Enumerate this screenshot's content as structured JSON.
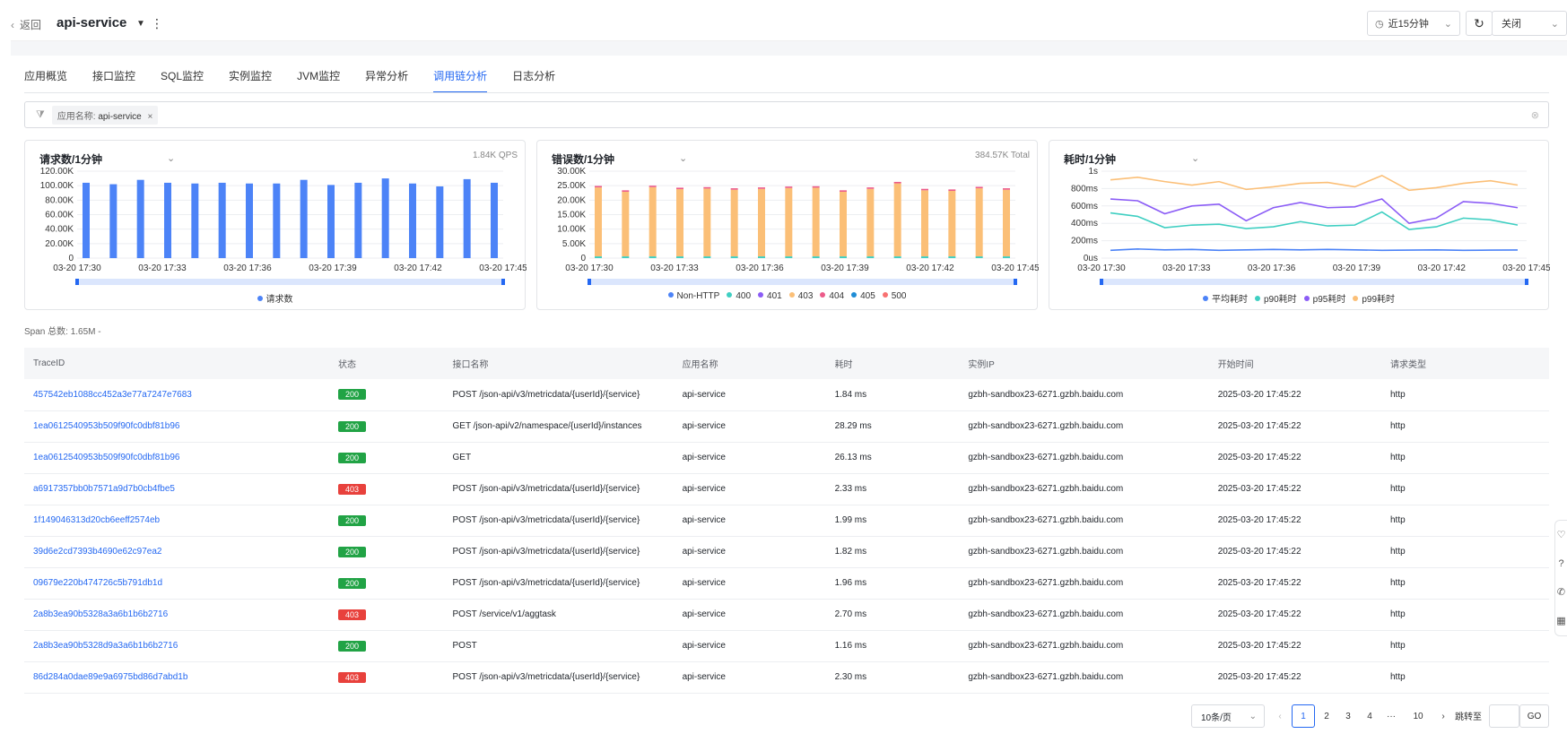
{
  "header": {
    "back_label": "返回",
    "service_name": "api-service",
    "time_range": "近15分钟",
    "refresh_mode": "关闭"
  },
  "tabs": [
    "应用概览",
    "接口监控",
    "SQL监控",
    "实例监控",
    "JVM监控",
    "异常分析",
    "调用链分析",
    "日志分析"
  ],
  "active_tab": "调用链分析",
  "filter": {
    "chip_key": "应用名称:",
    "chip_value": "api-service"
  },
  "colors": {
    "accent": "#2468f2",
    "ok": "#21a345",
    "error": "#e8413c"
  },
  "chart_data": [
    {
      "type": "bar",
      "title": "请求数/1分钟",
      "stat": "1.84K QPS",
      "x_ticks": [
        "03-20 17:30",
        "03-20 17:33",
        "03-20 17:36",
        "03-20 17:39",
        "03-20 17:42",
        "03-20 17:45"
      ],
      "y_ticks": [
        "120.00K",
        "100.00K",
        "80.00K",
        "60.00K",
        "40.00K",
        "20.00K",
        "0"
      ],
      "ylim": [
        0,
        120000
      ],
      "series": [
        {
          "name": "请求数",
          "color": "#4c83f7",
          "values": [
            104000,
            102000,
            108000,
            104000,
            103000,
            104000,
            103000,
            103000,
            108000,
            101000,
            104000,
            110000,
            103000,
            99000,
            109000,
            104000
          ]
        }
      ],
      "legend": [
        "请求数"
      ]
    },
    {
      "type": "bar",
      "stacked": true,
      "title": "错误数/1分钟",
      "stat": "384.57K Total",
      "x_ticks": [
        "03-20 17:30",
        "03-20 17:33",
        "03-20 17:36",
        "03-20 17:39",
        "03-20 17:42",
        "03-20 17:45"
      ],
      "y_ticks": [
        "30.00K",
        "25.00K",
        "20.00K",
        "15.00K",
        "10.00K",
        "5.00K",
        "0"
      ],
      "ylim": [
        0,
        30000
      ],
      "series": [
        {
          "name": "Non-HTTP",
          "color": "#4c83f7",
          "values": [
            0,
            0,
            0,
            0,
            0,
            0,
            0,
            0,
            0,
            0,
            0,
            0,
            0,
            0,
            0,
            0
          ]
        },
        {
          "name": "400",
          "color": "#3fcfc2",
          "values": [
            600,
            600,
            600,
            600,
            600,
            600,
            600,
            600,
            600,
            600,
            600,
            600,
            600,
            600,
            600,
            600
          ]
        },
        {
          "name": "401",
          "color": "#8b5cf6",
          "values": [
            0,
            0,
            0,
            0,
            0,
            0,
            0,
            0,
            0,
            0,
            0,
            0,
            0,
            0,
            0,
            0
          ]
        },
        {
          "name": "403",
          "color": "#fbbf77",
          "values": [
            23800,
            22300,
            23900,
            23200,
            23400,
            23000,
            23300,
            23600,
            23700,
            22300,
            23300,
            25200,
            22800,
            22600,
            23500,
            23000
          ]
        },
        {
          "name": "404",
          "color": "#ec5b8a",
          "values": [
            500,
            500,
            500,
            500,
            500,
            500,
            500,
            500,
            500,
            500,
            500,
            500,
            500,
            500,
            500,
            500
          ]
        },
        {
          "name": "405",
          "color": "#1f8dd6",
          "values": [
            0,
            0,
            0,
            0,
            0,
            0,
            0,
            0,
            0,
            0,
            0,
            0,
            0,
            0,
            0,
            0
          ]
        },
        {
          "name": "500",
          "color": "#f87171",
          "values": [
            0,
            0,
            0,
            0,
            0,
            0,
            0,
            0,
            0,
            0,
            0,
            0,
            0,
            0,
            0,
            0
          ]
        }
      ],
      "legend": [
        "Non-HTTP",
        "400",
        "401",
        "403",
        "404",
        "405",
        "500"
      ]
    },
    {
      "type": "line",
      "title": "耗时/1分钟",
      "x_ticks": [
        "03-20 17:30",
        "03-20 17:33",
        "03-20 17:36",
        "03-20 17:39",
        "03-20 17:42",
        "03-20 17:45"
      ],
      "y_ticks": [
        "1s",
        "800ms",
        "600ms",
        "400ms",
        "200ms",
        "0us"
      ],
      "ylim": [
        0,
        1000
      ],
      "series": [
        {
          "name": "平均耗时",
          "color": "#4c83f7",
          "values": [
            90,
            105,
            95,
            100,
            90,
            95,
            100,
            95,
            100,
            95,
            90,
            92,
            95,
            90,
            92,
            93
          ]
        },
        {
          "name": "p90耗时",
          "color": "#3fcfc2",
          "values": [
            520,
            480,
            350,
            380,
            390,
            340,
            360,
            420,
            370,
            380,
            530,
            330,
            360,
            460,
            440,
            380
          ]
        },
        {
          "name": "p95耗时",
          "color": "#8b5cf6",
          "values": [
            680,
            660,
            510,
            600,
            620,
            430,
            580,
            640,
            580,
            590,
            680,
            400,
            460,
            650,
            630,
            580
          ]
        },
        {
          "name": "p99耗时",
          "color": "#fbbf77",
          "values": [
            900,
            930,
            880,
            840,
            880,
            790,
            820,
            860,
            870,
            820,
            950,
            780,
            810,
            860,
            890,
            840
          ]
        }
      ],
      "legend": [
        "平均耗时",
        "p90耗时",
        "p95耗时",
        "p99耗时"
      ]
    }
  ],
  "span_total": "Span 总数:  1.65M -",
  "table": {
    "headers": [
      "TraceID",
      "状态",
      "接口名称",
      "应用名称",
      "耗时",
      "实例IP",
      "开始时间",
      "请求类型"
    ],
    "rows": [
      [
        "457542eb1088cc452a3e77a7247e7683",
        "200",
        "POST /json-api/v3/metricdata/{userId}/{service}",
        "api-service",
        "1.84 ms",
        "gzbh-sandbox23-6271.gzbh.baidu.com",
        "2025-03-20 17:45:22",
        "http"
      ],
      [
        "1ea0612540953b509f90fc0dbf81b96",
        "200",
        "GET /json-api/v2/namespace/{userId}/instances",
        "api-service",
        "28.29 ms",
        "gzbh-sandbox23-6271.gzbh.baidu.com",
        "2025-03-20 17:45:22",
        "http"
      ],
      [
        "1ea0612540953b509f90fc0dbf81b96",
        "200",
        "GET",
        "api-service",
        "26.13 ms",
        "gzbh-sandbox23-6271.gzbh.baidu.com",
        "2025-03-20 17:45:22",
        "http"
      ],
      [
        "a6917357bb0b7571a9d7b0cb4fbe5",
        "403",
        "POST /json-api/v3/metricdata/{userId}/{service}",
        "api-service",
        "2.33 ms",
        "gzbh-sandbox23-6271.gzbh.baidu.com",
        "2025-03-20 17:45:22",
        "http"
      ],
      [
        "1f149046313d20cb6eeff2574eb",
        "200",
        "POST /json-api/v3/metricdata/{userId}/{service}",
        "api-service",
        "1.99 ms",
        "gzbh-sandbox23-6271.gzbh.baidu.com",
        "2025-03-20 17:45:22",
        "http"
      ],
      [
        "39d6e2cd7393b4690e62c97ea2",
        "200",
        "POST /json-api/v3/metricdata/{userId}/{service}",
        "api-service",
        "1.82 ms",
        "gzbh-sandbox23-6271.gzbh.baidu.com",
        "2025-03-20 17:45:22",
        "http"
      ],
      [
        "09679e220b474726c5b791db1d",
        "200",
        "POST /json-api/v3/metricdata/{userId}/{service}",
        "api-service",
        "1.96 ms",
        "gzbh-sandbox23-6271.gzbh.baidu.com",
        "2025-03-20 17:45:22",
        "http"
      ],
      [
        "2a8b3ea90b5328a3a6b1b6b2716",
        "403",
        "POST /service/v1/aggtask",
        "api-service",
        "2.70 ms",
        "gzbh-sandbox23-6271.gzbh.baidu.com",
        "2025-03-20 17:45:22",
        "http"
      ],
      [
        "2a8b3ea90b5328d9a3a6b1b6b2716",
        "200",
        "POST",
        "api-service",
        "1.16 ms",
        "gzbh-sandbox23-6271.gzbh.baidu.com",
        "2025-03-20 17:45:22",
        "http"
      ],
      [
        "86d284a0dae89e9a6975bd86d7abd1b",
        "403",
        "POST /json-api/v3/metricdata/{userId}/{service}",
        "api-service",
        "2.30 ms",
        "gzbh-sandbox23-6271.gzbh.baidu.com",
        "2025-03-20 17:45:22",
        "http"
      ]
    ]
  },
  "pagination": {
    "page_size": "10条/页",
    "pages": [
      "1",
      "2",
      "3",
      "4",
      "···",
      "10"
    ],
    "current": "1",
    "jump_label": "跳转至",
    "go_label": "GO"
  }
}
